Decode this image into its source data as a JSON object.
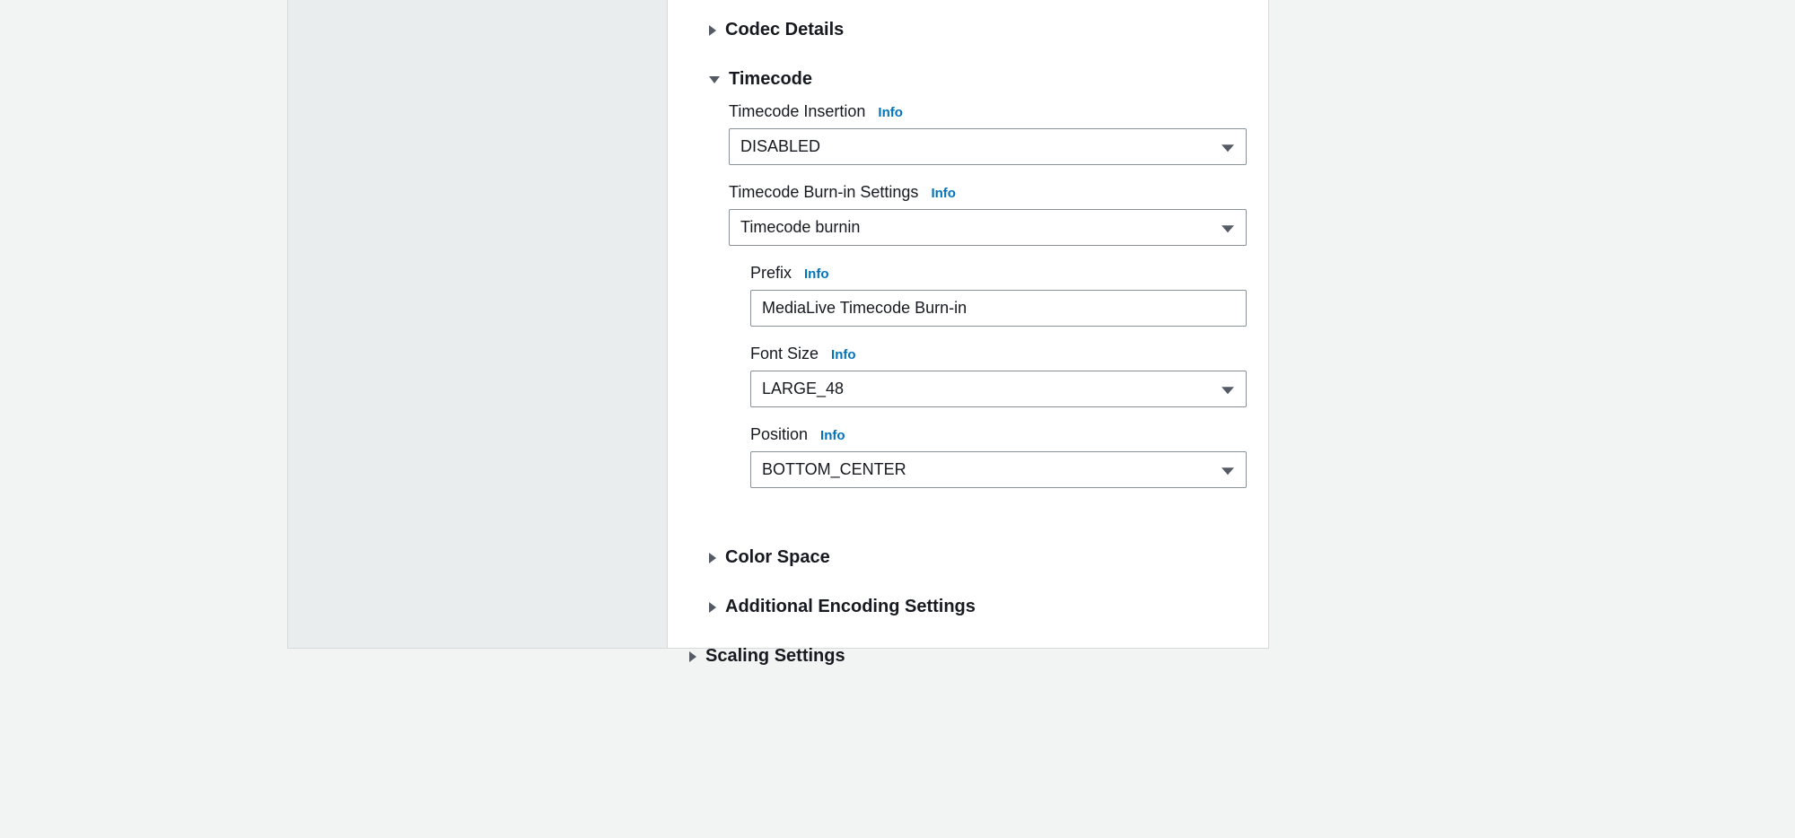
{
  "sections": {
    "codec_details": "Codec Details",
    "timecode": "Timecode",
    "color_space": "Color Space",
    "additional_encoding": "Additional Encoding Settings",
    "scaling_settings": "Scaling Settings"
  },
  "timecode": {
    "insertion_label": "Timecode Insertion",
    "insertion_value": "DISABLED",
    "burnin_label": "Timecode Burn-in Settings",
    "burnin_value": "Timecode burnin",
    "prefix_label": "Prefix",
    "prefix_value": "MediaLive Timecode Burn-in",
    "fontsize_label": "Font Size",
    "fontsize_value": "LARGE_48",
    "position_label": "Position",
    "position_value": "BOTTOM_CENTER"
  },
  "info_label": "Info"
}
